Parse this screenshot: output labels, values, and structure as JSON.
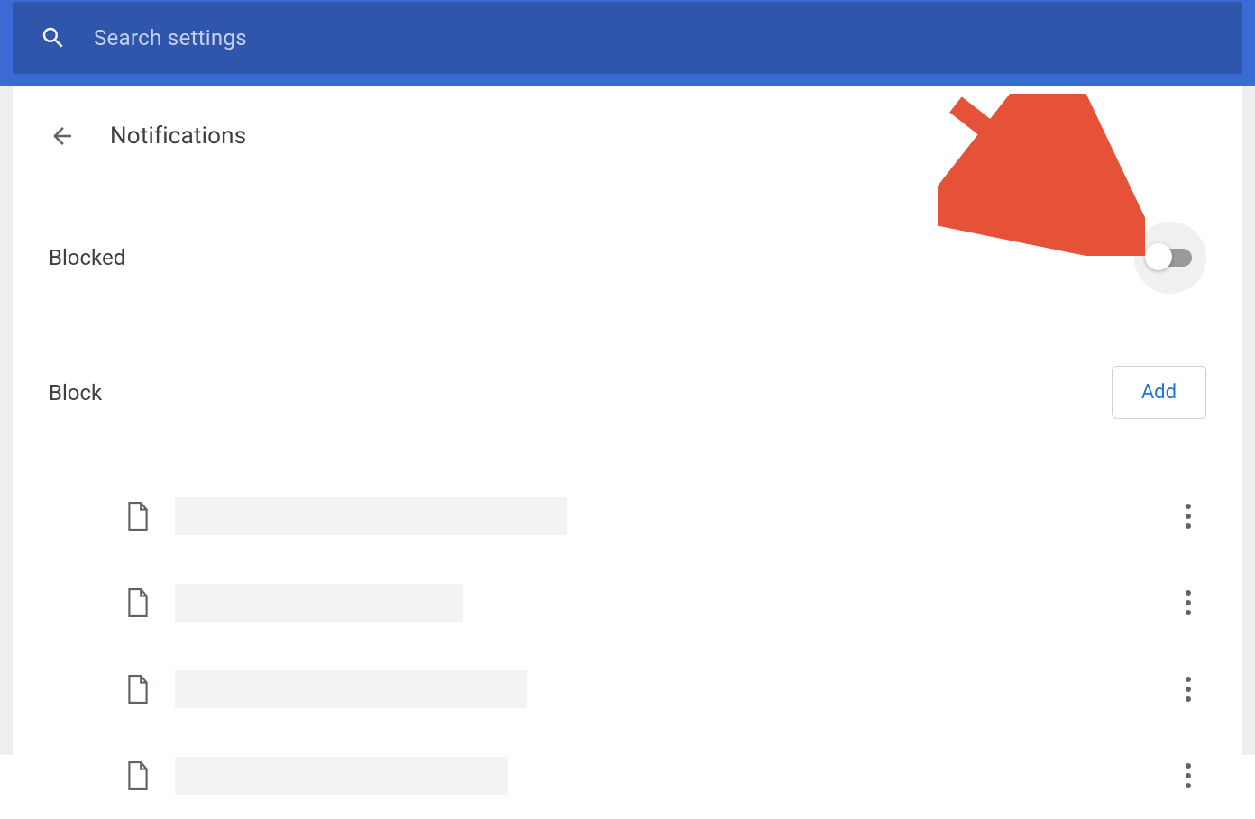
{
  "search": {
    "placeholder": "Search settings"
  },
  "page": {
    "title": "Notifications"
  },
  "settings": {
    "blocked_label": "Blocked",
    "blocked_state": "off"
  },
  "block_section": {
    "label": "Block",
    "add_button": "Add",
    "items": [
      {
        "placeholder_width": 435
      },
      {
        "placeholder_width": 320
      },
      {
        "placeholder_width": 390
      },
      {
        "placeholder_width": 370
      }
    ]
  },
  "annotation": {
    "arrow_color": "#e55238"
  }
}
